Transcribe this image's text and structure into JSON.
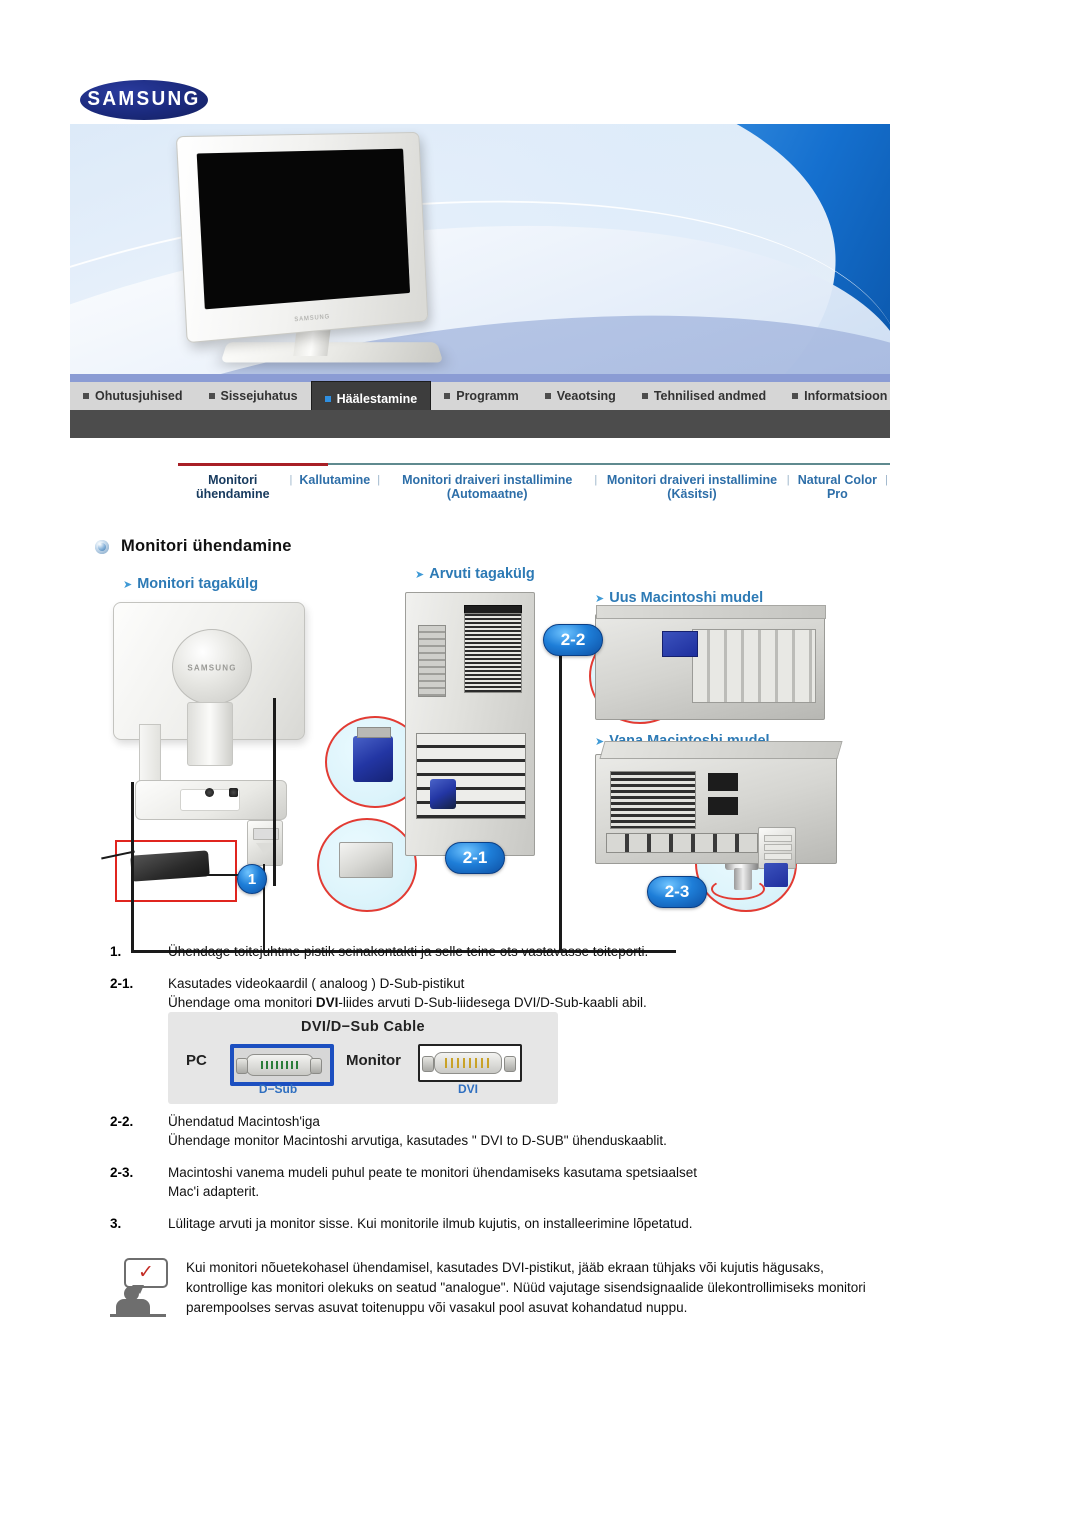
{
  "brand": {
    "logo_text": "SAMSUNG"
  },
  "mainnav": {
    "items": [
      {
        "label": "Ohutusjuhised",
        "active": false
      },
      {
        "label": "Sissejuhatus",
        "active": false
      },
      {
        "label": "Häälestamine",
        "active": true
      },
      {
        "label": "Programm",
        "active": false
      },
      {
        "label": "Veaotsing",
        "active": false
      },
      {
        "label": "Tehnilised andmed",
        "active": false
      },
      {
        "label": "Informatsioon",
        "active": false
      }
    ]
  },
  "subnav": {
    "separator": "|",
    "items": [
      {
        "label": "Monitori ühendamine",
        "active": true
      },
      {
        "label": "Kallutamine",
        "active": false
      },
      {
        "label": "Monitori draiveri installimine (Automaatne)",
        "active": false
      },
      {
        "label": "Monitori draiveri installimine (Käsitsi)",
        "active": false
      },
      {
        "label": "Natural Color Pro",
        "active": false
      }
    ]
  },
  "section": {
    "title": "Monitori ühendamine"
  },
  "diagram": {
    "labels": {
      "monitor_back": "Monitori tagakülg",
      "computer_back": "Arvuti tagakülg",
      "new_mac": "Uus Macintoshi mudel",
      "old_mac": "Vana Macintoshi mudel"
    },
    "badges": {
      "one": "1",
      "two_one": "2-1",
      "two_two": "2-2",
      "two_three": "2-3"
    },
    "monitor_logo": "SAMSUNG"
  },
  "steps": [
    {
      "num": "1.",
      "lines": [
        "Ühendage toitejuhtme pistik seinakontakti ja selle teine ots vastavasse toiteporti."
      ]
    },
    {
      "num": "2-1.",
      "lines": [
        "Kasutades videokaardil ( analoog ) D-Sub-pistikut",
        "Ühendage oma monitori DVI-liides arvuti D-Sub-liidesega DVI/D-Sub-kaabli abil."
      ],
      "bold_word": "DVI"
    },
    {
      "num": "2-2.",
      "lines": [
        "Ühendatud Macintosh'iga",
        "Ühendage monitor Macintoshi arvutiga, kasutades \" DVI to D-SUB\" ühenduskaablit."
      ]
    },
    {
      "num": "2-3.",
      "lines": [
        "Macintoshi vanema mudeli puhul peate te monitori ühendamiseks kasutama spetsiaalset",
        "Mac'i adapterit."
      ]
    },
    {
      "num": "3.",
      "lines": [
        "Lülitage arvuti ja monitor sisse. Kui monitorile ilmub kujutis, on installeerimine lõpetatud."
      ]
    }
  ],
  "cable_figure": {
    "title": "DVI/D−Sub Cable",
    "pc_label": "PC",
    "monitor_label": "Monitor",
    "dsub_label": "D−Sub",
    "dvi_label": "DVI"
  },
  "note": {
    "icon_name": "info-person-icon",
    "check_glyph": "✓",
    "text": "Kui monitori nõuetekohasel ühendamisel, kasutades DVI-pistikut, jääb ekraan tühjaks või kujutis hägusaks, kontrollige kas monitori olekuks on seatud \"analogue\". Nüüd vajutage sisendsignaalide ülekontrollimiseks monitori parempoolses servas asuvat toitenuppu või vasakul pool asuvat kohandatud nuppu."
  }
}
